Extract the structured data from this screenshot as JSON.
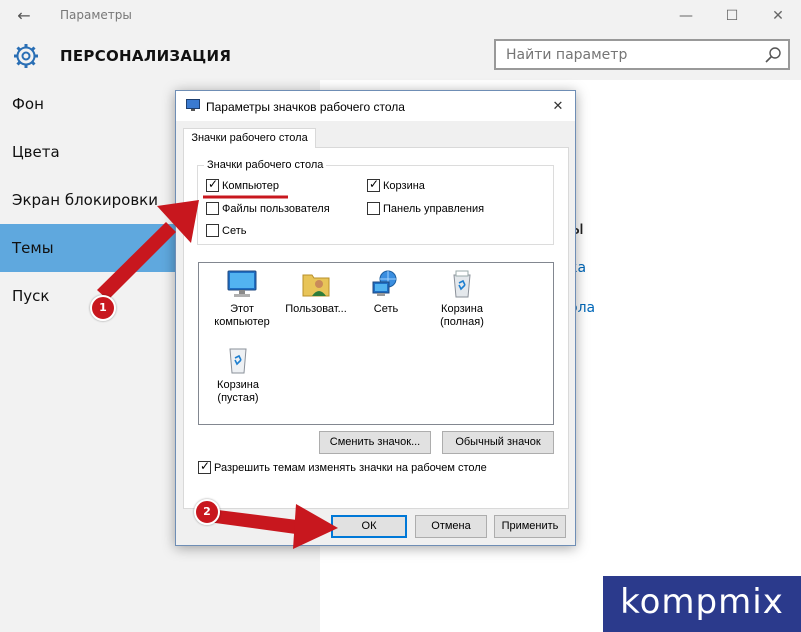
{
  "window": {
    "title": "Параметры",
    "back_icon": "←",
    "min_icon": "—",
    "max_icon": "☐",
    "close_icon": "✕"
  },
  "header": {
    "section_title": "ПЕРСОНАЛИЗАЦИЯ",
    "search_placeholder": "Найти параметр"
  },
  "sidebar": {
    "items": [
      {
        "label": "Фон"
      },
      {
        "label": "Цвета"
      },
      {
        "label": "Экран блокировки"
      },
      {
        "label": "Темы",
        "active": true
      },
      {
        "label": "Пуск"
      }
    ]
  },
  "main": {
    "heading_fragment": "ы",
    "link1_fragment": "ка",
    "link2_fragment": "ола"
  },
  "dialog": {
    "title": "Параметры значков рабочего стола",
    "close_icon": "✕",
    "tab_label": "Значки рабочего стола",
    "group_label": "Значки рабочего стола",
    "checkboxes": [
      {
        "label": "Компьютер",
        "checked": true
      },
      {
        "label": "Корзина",
        "checked": true
      },
      {
        "label": "Файлы пользователя",
        "checked": false
      },
      {
        "label": "Панель управления",
        "checked": false
      },
      {
        "label": "Сеть",
        "checked": false
      }
    ],
    "icons": [
      {
        "label": "Этот компьютер",
        "icon": "computer-icon"
      },
      {
        "label": "Пользоват...",
        "icon": "user-folder-icon"
      },
      {
        "label": "Сеть",
        "icon": "network-icon"
      },
      {
        "label": "Корзина (полная)",
        "icon": "recycle-bin-full-icon"
      },
      {
        "label": "Корзина (пустая)",
        "icon": "recycle-bin-empty-icon"
      }
    ],
    "change_icon_button": "Сменить значок...",
    "default_icon_button": "Обычный значок",
    "allow_themes": {
      "label": "Разрешить темам изменять значки на рабочем столе",
      "checked": true
    },
    "ok_button": "ОК",
    "cancel_button": "Отмена",
    "apply_button": "Применить"
  },
  "annotations": {
    "marker1": "1",
    "marker2": "2",
    "accent_color": "#c8171e"
  },
  "watermark": {
    "text": "kompmix"
  },
  "colors": {
    "sidebar_bg": "#f2f2f2",
    "active_item": "#5fa8de",
    "link": "#0067b8",
    "ok_border": "#0078d7"
  }
}
